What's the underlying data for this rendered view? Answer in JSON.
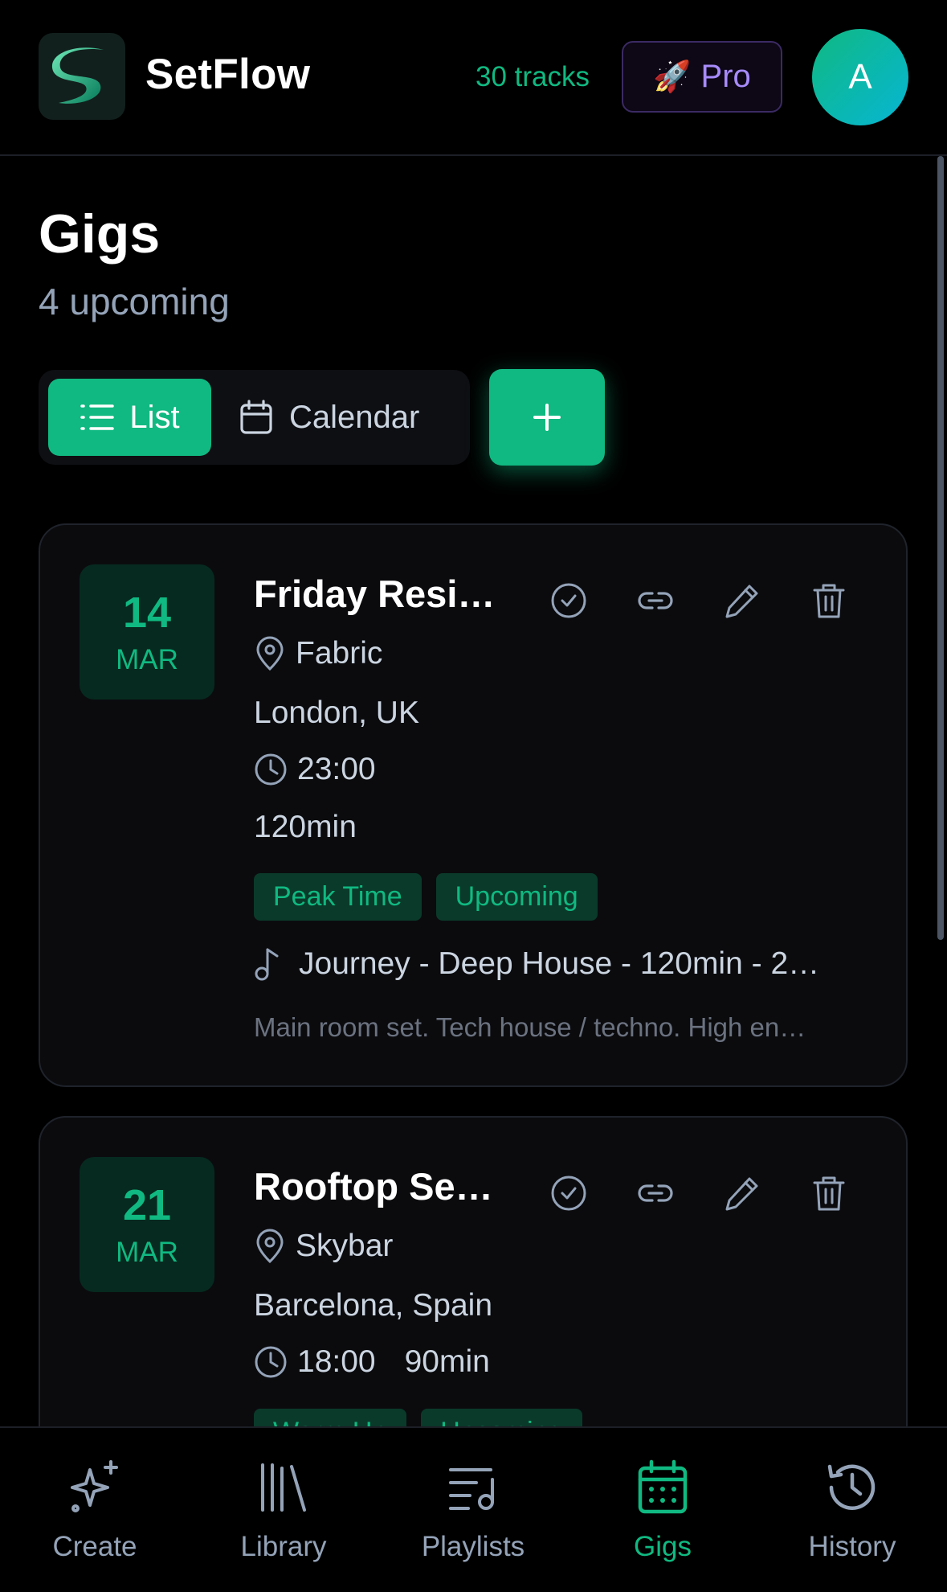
{
  "header": {
    "app_name": "SetFlow",
    "track_count": "30 tracks",
    "pro_label": "Pro",
    "avatar_initial": "A"
  },
  "page": {
    "title": "Gigs",
    "subtitle": "4 upcoming"
  },
  "view_toggle": {
    "list_label": "List",
    "calendar_label": "Calendar",
    "active": "List"
  },
  "gigs": [
    {
      "day": "14",
      "month": "MAR",
      "title": "Friday Resi…",
      "venue": "Fabric",
      "location": "London, UK",
      "time": "23:00",
      "duration": "120min",
      "tags": [
        "Peak Time",
        "Upcoming"
      ],
      "playlist": "Journey - Deep House - 120min - 2…",
      "notes": "Main room set. Tech house / techno. High en…"
    },
    {
      "day": "21",
      "month": "MAR",
      "title": "Rooftop Se…",
      "venue": "Skybar",
      "location": "Barcelona, Spain",
      "time": "18:00",
      "duration": "90min",
      "tags": [
        "Warm Up",
        "Upcoming"
      ]
    }
  ],
  "bottom_nav": {
    "items": [
      {
        "label": "Create",
        "icon": "sparkle-icon"
      },
      {
        "label": "Library",
        "icon": "library-icon"
      },
      {
        "label": "Playlists",
        "icon": "playlist-icon"
      },
      {
        "label": "Gigs",
        "icon": "calendar-icon"
      },
      {
        "label": "History",
        "icon": "history-icon"
      }
    ],
    "active": "Gigs"
  },
  "colors": {
    "accent": "#10b981",
    "pro": "#a78bfa",
    "muted": "#94a3b8",
    "card_bg": "#0b0b0e"
  }
}
